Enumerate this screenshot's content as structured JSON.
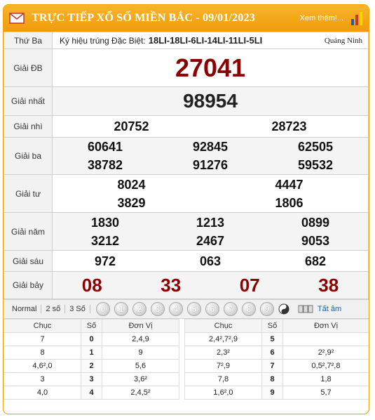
{
  "header": {
    "title": "TRỰC TIẾP XỔ SỐ MIỀN BẮC - 09/01/2023",
    "more": "Xem thêm!..."
  },
  "special_info": {
    "day": "Thứ Ba",
    "label": "Ký hiệu trúng Đặc Biệt:",
    "codes": "18LI-18LI-6LI-14LI-11LI-5LI",
    "place": "Quảng Ninh"
  },
  "prizes": {
    "db": {
      "label": "Giải ĐB",
      "numbers": [
        "27041"
      ]
    },
    "nhat": {
      "label": "Giải nhất",
      "numbers": [
        "98954"
      ]
    },
    "nhi": {
      "label": "Giải nhì",
      "numbers": [
        "20752",
        "28723"
      ]
    },
    "ba": {
      "label": "Giải ba",
      "numbers": [
        "60641",
        "92845",
        "62505",
        "38782",
        "91276",
        "59532"
      ]
    },
    "tu": {
      "label": "Giải tư",
      "numbers": [
        "8024",
        "4447",
        "3829",
        "1806"
      ]
    },
    "nam": {
      "label": "Giải năm",
      "numbers": [
        "1830",
        "1213",
        "0899",
        "3212",
        "2467",
        "9053"
      ]
    },
    "sau": {
      "label": "Giải sáu",
      "numbers": [
        "972",
        "063",
        "682"
      ]
    },
    "bay": {
      "label": "Giải bảy",
      "numbers": [
        "08",
        "33",
        "07",
        "38"
      ]
    }
  },
  "toolbar": {
    "options": [
      "Normal",
      "2 số",
      "3 Số"
    ],
    "digits": [
      "0",
      "1",
      "2",
      "3",
      "4",
      "5",
      "6",
      "7",
      "8",
      "9"
    ],
    "all_label": "Tất âm"
  },
  "loto": {
    "headers": [
      "Chục",
      "Số",
      "Đơn Vị",
      "Chục",
      "Số",
      "Đơn Vị"
    ],
    "rows": [
      {
        "chuc_l": "7",
        "so_l": "0",
        "dv_l": "2,4,9",
        "chuc_r": "2,4²,7²,9",
        "so_r": "5",
        "dv_r": ""
      },
      {
        "chuc_l": "8",
        "so_l": "1",
        "dv_l": "9",
        "chuc_r": "2,3²",
        "so_r": "6",
        "dv_r": "2²,9²"
      },
      {
        "chuc_l": "4,6²,0",
        "so_l": "2",
        "dv_l": "5,6",
        "chuc_r": "7²,9",
        "so_r": "7",
        "dv_r": "0,5²,7²,8"
      },
      {
        "chuc_l": "3",
        "so_l": "3",
        "dv_l": "3,6²",
        "chuc_r": "7,8",
        "so_r": "8",
        "dv_r": "1,8"
      },
      {
        "chuc_l": "4,0",
        "so_l": "4",
        "dv_l": "2,4,5²",
        "chuc_r": "1,6²,0",
        "so_r": "9",
        "dv_r": "5,7"
      }
    ]
  },
  "colors": {
    "accent": "#f29a0c",
    "special": "#8b0000"
  }
}
